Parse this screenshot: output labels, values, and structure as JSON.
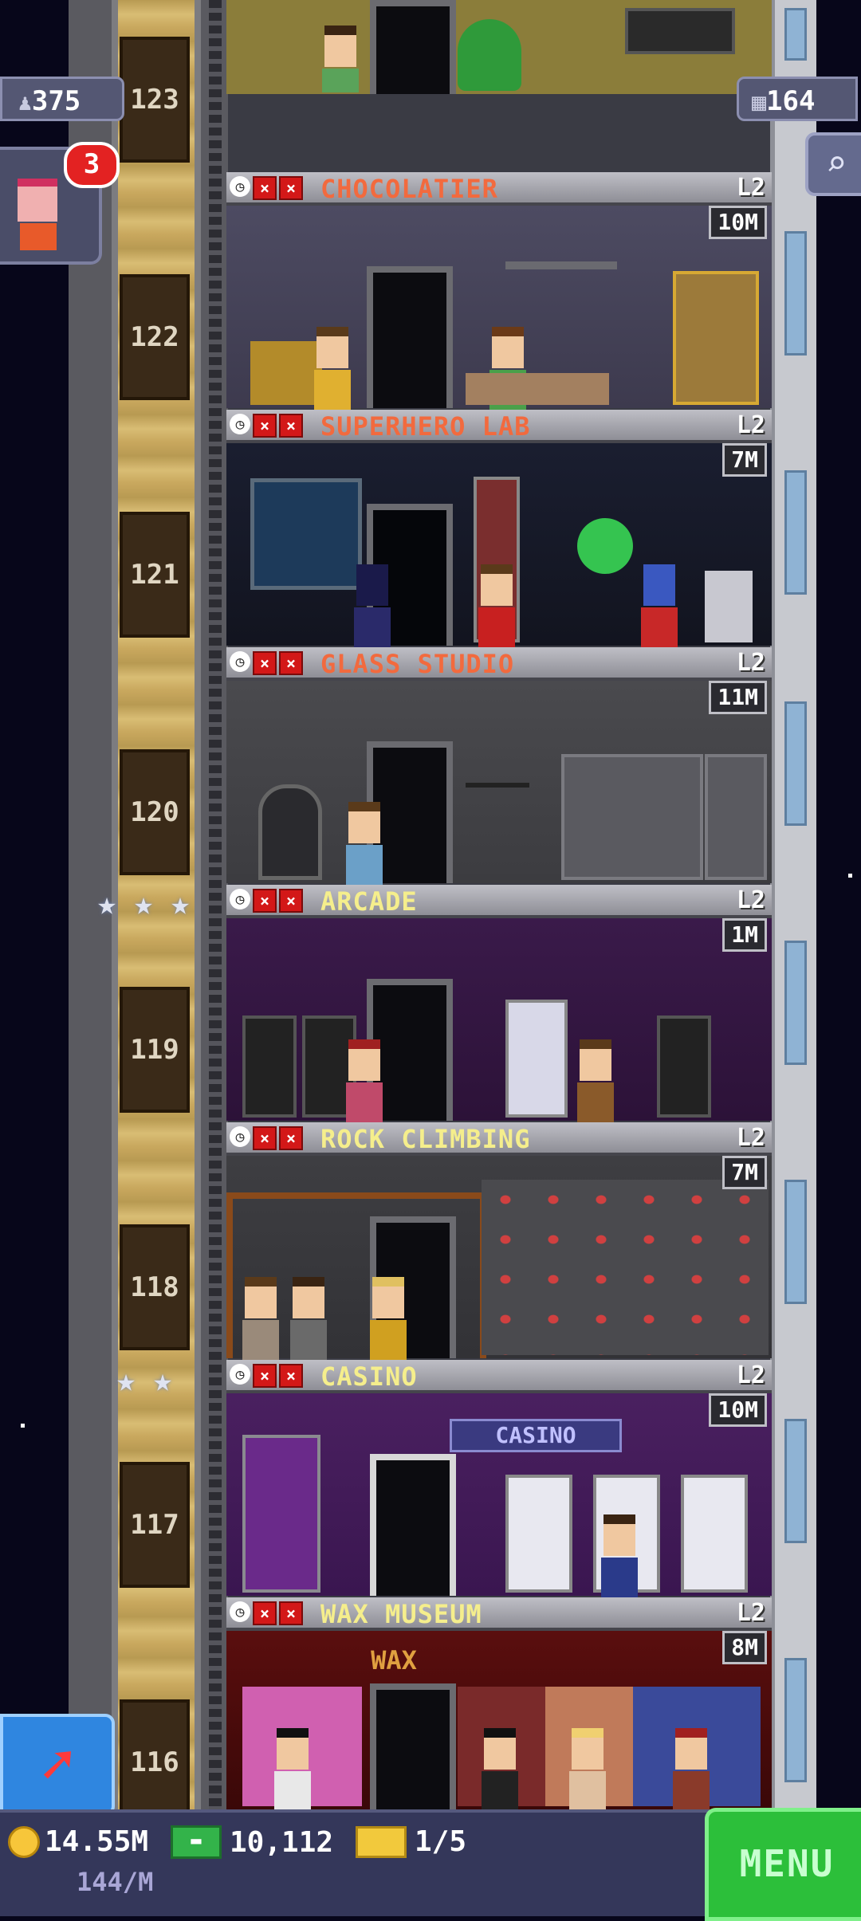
{
  "hud": {
    "population": "375",
    "population_icon": "person-icon",
    "floors_count": "164",
    "floors_icon": "building-icon",
    "notification_count": "3"
  },
  "floors": [
    {
      "number": "123",
      "name": "",
      "level": "",
      "time": ""
    },
    {
      "number": "122",
      "name": "CHOCOLATIER",
      "level": "L2",
      "time": "10M",
      "name_color": "#f26a3e"
    },
    {
      "number": "121",
      "name": "SUPERHERO LAB",
      "level": "L2",
      "time": "7M",
      "name_color": "#f26a3e"
    },
    {
      "number": "120",
      "name": "GLASS STUDIO",
      "level": "L2",
      "time": "11M",
      "name_color": "#f26a3e"
    },
    {
      "number": "119",
      "name": "ARCADE",
      "level": "L2",
      "time": "1M",
      "name_color": "#f5ee8c"
    },
    {
      "number": "118",
      "name": "ROCK CLIMBING",
      "level": "L2",
      "time": "7M",
      "name_color": "#f5ee8c"
    },
    {
      "number": "117",
      "name": "CASINO",
      "level": "L2",
      "time": "10M",
      "name_color": "#f5ee8c"
    },
    {
      "number": "116",
      "name": "WAX MUSEUM",
      "level": "L2",
      "time": "8M",
      "name_color": "#f5ee8c"
    }
  ],
  "room_signs": {
    "casino_sign": "CASINO",
    "wax_sign": "WAX"
  },
  "bottom": {
    "coins": "14.55M",
    "coin_rate": "144/M",
    "bux": "10,112",
    "tickets": "1/5",
    "menu_label": "MENU"
  }
}
